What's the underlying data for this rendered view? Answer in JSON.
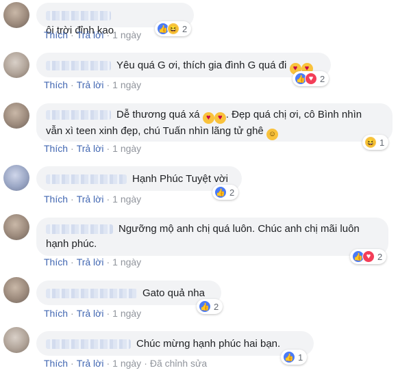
{
  "actions": {
    "like": "Thích",
    "reply": "Trả lời",
    "time": "1 ngày",
    "edited": "Đã chỉnh sửa",
    "dot": "·"
  },
  "emoji_glyphs": {
    "heart_eyes": "♥",
    "kiss": "♥",
    "laugh": "☺"
  },
  "reaction_icons": {
    "like": "👍",
    "haha": "😆",
    "love": "♥"
  },
  "comments": [
    {
      "text": "ôi trời đỉnh kao",
      "reactions": [
        "like",
        "haha"
      ],
      "count": "2"
    },
    {
      "text": "Yêu quá G ơi, thích gia đình G quá đi",
      "reactions": [
        "like",
        "love"
      ],
      "count": "2"
    },
    {
      "text_line1": "Dễ thương quá xá",
      "text_line1b": ". Đẹp quá chị ơi, cô Bình nhìn",
      "text_line2": "vẫn xì teen xinh đẹp, chú Tuấn nhìn lãng tử ghê",
      "reactions": [
        "haha"
      ],
      "count": "1"
    },
    {
      "text": "Hạnh Phúc Tuyệt vời",
      "reactions": [
        "like"
      ],
      "count": "2"
    },
    {
      "text_line1": "Ngưỡng mộ anh chị quá luôn. Chúc anh chị mãi luôn",
      "text_line2": "hạnh phúc.",
      "reactions": [
        "like",
        "love"
      ],
      "count": "2"
    },
    {
      "text": "Gato quả nha",
      "reactions": [
        "like"
      ],
      "count": "2"
    },
    {
      "text": "Chúc mừng hạnh phúc hai bạn.",
      "reactions": [
        "like"
      ],
      "count": "1"
    }
  ]
}
